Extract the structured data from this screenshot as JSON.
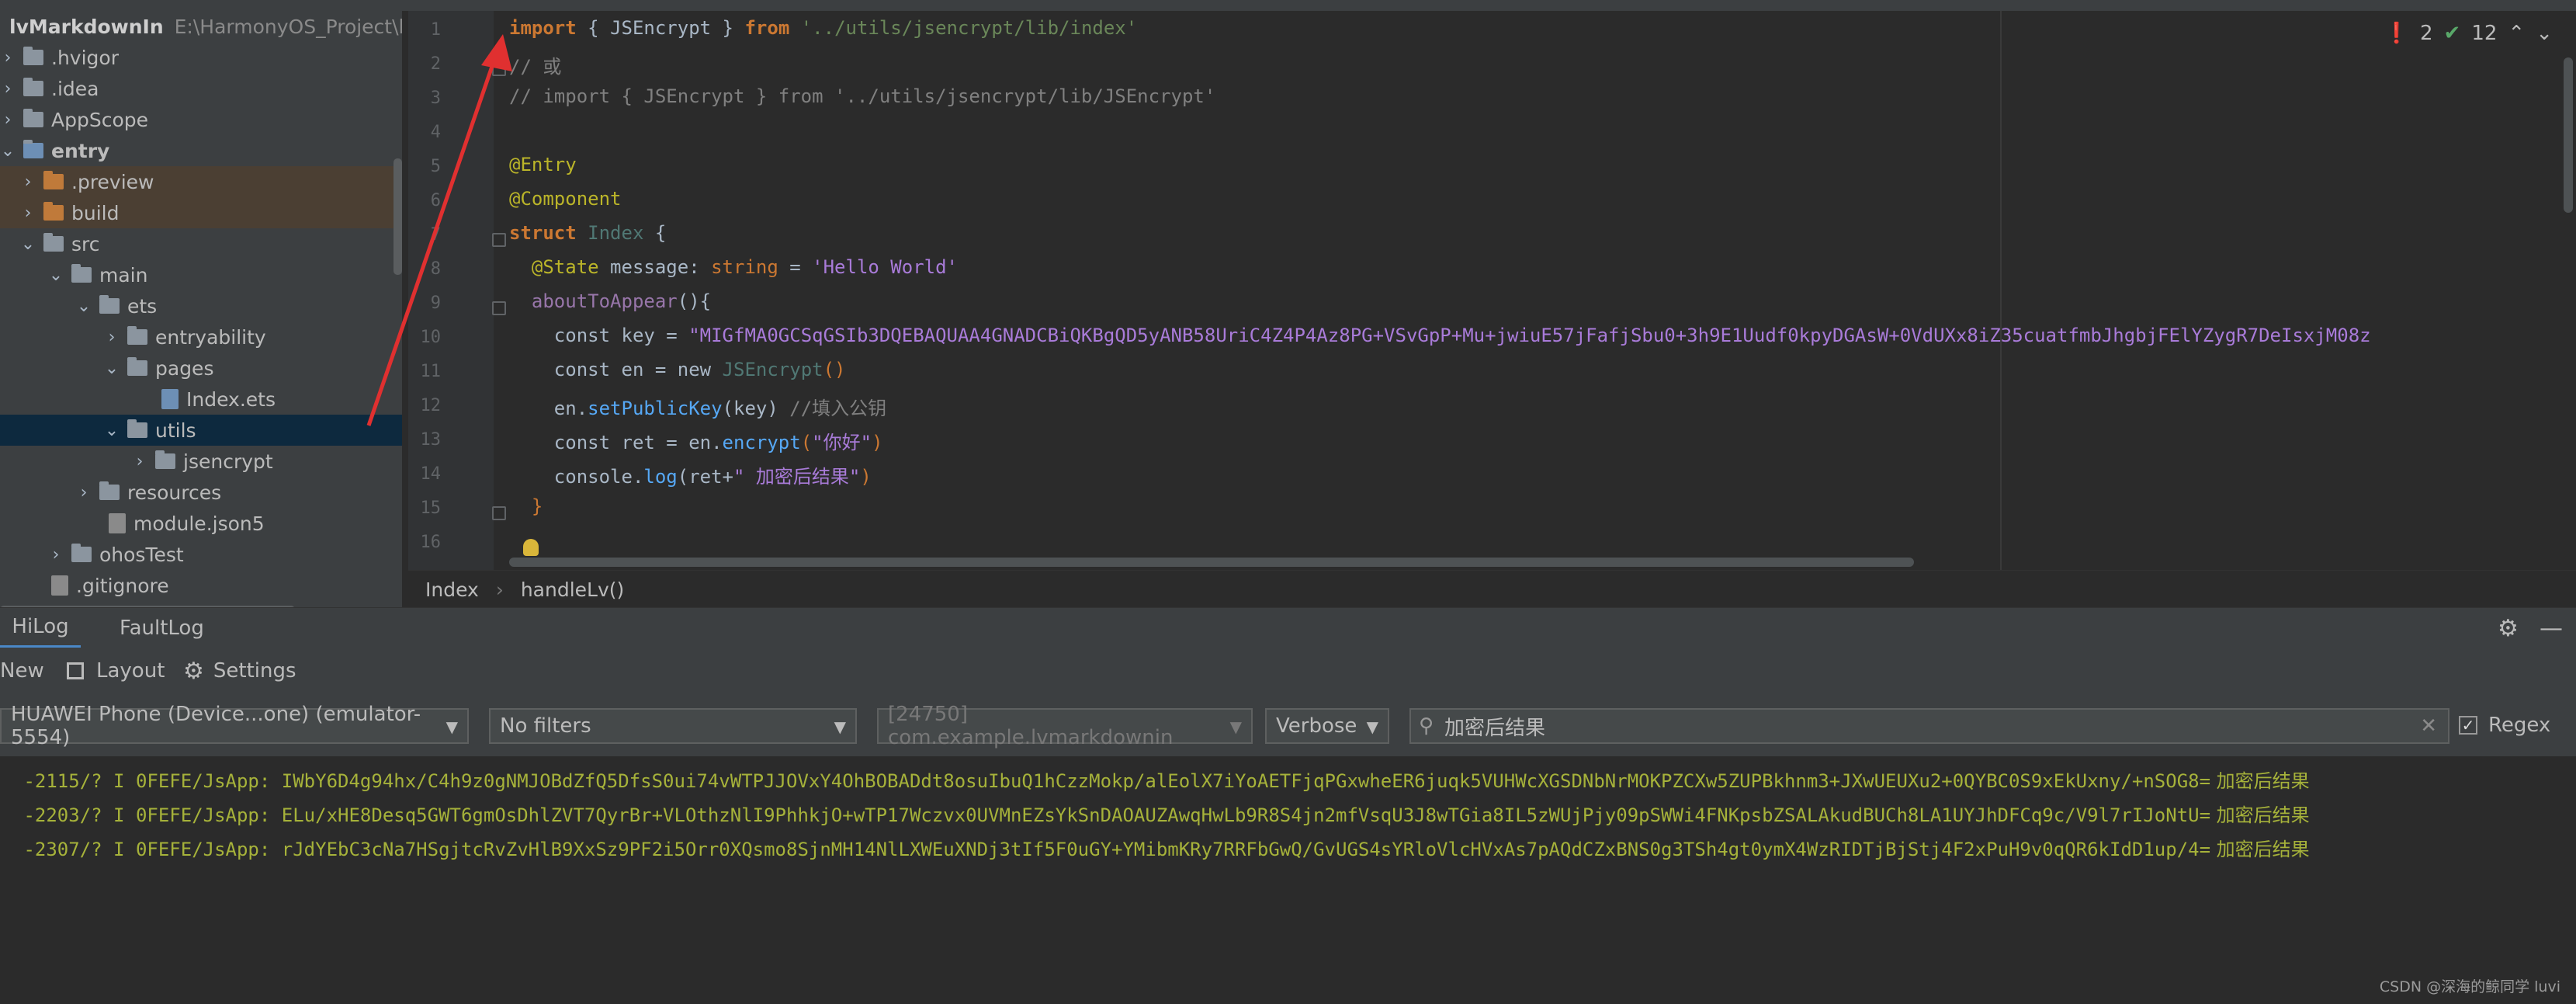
{
  "project": {
    "root_name": "lvMarkdownIn",
    "root_path": "E:\\HarmonyOS_Project\\lvM",
    "items": [
      {
        "label": ".hvigor",
        "kind": "folder"
      },
      {
        "label": ".idea",
        "kind": "folder"
      },
      {
        "label": "AppScope",
        "kind": "folder"
      },
      {
        "label": "entry",
        "kind": "folder"
      },
      {
        "label": ".preview",
        "kind": "folder-orange"
      },
      {
        "label": "build",
        "kind": "folder-orange"
      },
      {
        "label": "src",
        "kind": "folder"
      },
      {
        "label": "main",
        "kind": "folder"
      },
      {
        "label": "ets",
        "kind": "folder"
      },
      {
        "label": "entryability",
        "kind": "folder"
      },
      {
        "label": "pages",
        "kind": "folder"
      },
      {
        "label": "Index.ets",
        "kind": "file"
      },
      {
        "label": "utils",
        "kind": "folder"
      },
      {
        "label": "jsencrypt",
        "kind": "folder"
      },
      {
        "label": "resources",
        "kind": "folder"
      },
      {
        "label": "module.json5",
        "kind": "file"
      },
      {
        "label": "ohosTest",
        "kind": "folder"
      },
      {
        "label": ".gitignore",
        "kind": "file"
      }
    ]
  },
  "editor": {
    "line_numbers": [
      "1",
      "2",
      "3",
      "4",
      "5",
      "6",
      "7",
      "8",
      "9",
      "10",
      "11",
      "12",
      "13",
      "14",
      "15",
      "16"
    ],
    "code": {
      "l1_import": "import",
      "l1_open": " { ",
      "l1_name": "JSEncrypt",
      "l1_close": " } ",
      "l1_from": "from",
      "l1_path": " '../utils/jsencrypt/lib/index'",
      "l2": "// 或",
      "l3": "// import { JSEncrypt } from '../utils/jsencrypt/lib/JSEncrypt'",
      "l5": "@Entry",
      "l6": "@Component",
      "l7_struct": "struct",
      "l7_name": " Index",
      "l7_brace": " {",
      "l8_dec": "  @State",
      "l8_prop": " message",
      "l8_colon": ": ",
      "l8_type": "string",
      "l8_eq": " = ",
      "l8_val": "'Hello World'",
      "l9_fn": "  aboutToAppear",
      "l9_rest": "(){",
      "l10_const": "    const",
      "l10_rest": " key = ",
      "l10_val": "\"MIGfMA0GCSqGSIb3DQEBAQUAA4GNADCBiQKBgQD5yANB58UriC4Z4P4Az8PG+VSvGpP+Mu+jwiuE57jFafjSbu0+3h9E1Uudf0kpyDGAsW+0VdUXx8iZ35cuatfmbJhgbjFElYZygR7DeIsxjM08z",
      "l11_const": "    const",
      "l11_rest": " en = ",
      "l11_new": "new",
      "l11_cls": " JSEncrypt",
      "l11_paren": "()",
      "l12_obj": "    en.",
      "l12_fn": "setPublicKey",
      "l12_args": "(key) ",
      "l12_cmt": "//填入公钥",
      "l13_const": "    const",
      "l13_rest": " ret = en.",
      "l13_fn": "encrypt",
      "l13_open": "(",
      "l13_val": "\"你好\"",
      "l13_close": ")",
      "l14_obj": "    console.",
      "l14_fn": "log",
      "l14_open": "(ret+",
      "l14_val": "\" 加密后结果\"",
      "l14_close": ")",
      "l15": "  }"
    },
    "inspection": {
      "errors": "2",
      "ok": "12"
    }
  },
  "breadcrumb": {
    "items": [
      "Index",
      "handleLv()"
    ]
  },
  "panel": {
    "tabs": [
      "HiLog",
      "FaultLog"
    ],
    "toolbar": {
      "new": "New",
      "layout": "Layout",
      "settings": "Settings"
    },
    "device": "HUAWEI Phone (Device...one) (emulator-5554)",
    "filter": "No filters",
    "process": "[24750] com.example.lvmarkdownin",
    "level": "Verbose",
    "search_value": "加密后结果",
    "regex_label": "Regex",
    "regex_checked": true
  },
  "log": {
    "lines": [
      {
        "text": " -2115/? I 0FEFE/JsApp: IWbY6D4g94hx/C4h9z0gNMJOBdZfQ5DfsS0ui74vWTPJJOVxY4OhBOBADdt8osuIbuQ1hCzzMokp/alEolX7iYoAETFjqPGxwheER6juqk5VUHWcXGSDNbNrMOKPZCXw5ZUPBkhnm3+JXwUEUXu2+0QYBC0S9xEkUxny/+nSOG8=",
        "tail": " 加密后结果"
      },
      {
        "text": " -2203/? I 0FEFE/JsApp: ELu/xHE8Desq5GWT6gmOsDhlZVT7QyrBr+VLOthzNlI9PhhkjO+wTP17Wczvx0UVMnEZsYkSnDAOAUZAwqHwLb9R8S4jn2mfVsqU3J8wTGia8IL5zWUjPjy09pSWWi4FNKpsbZSALAkudBUCh8LA1UYJhDFCq9c/V9l7rIJoNtU=",
        "tail": " 加密后结果"
      },
      {
        "text": " -2307/? I 0FEFE/JsApp: rJdYEbC3cNa7HSgjtcRvZvHlB9XxSz9PF2i5Orr0XQsmo8SjnMH14NlLXWEuXNDj3tIf5F0uGY+YMibmKRy7RRFbGwQ/GvUGS4sYRloVlcHVxAs7pAQdCZxBNS0g3TSh4gt0ymX4WzRIDTjBjStj4F2xPuH9v0qQR6kIdD1up/4=",
        "tail": " 加密后结果"
      }
    ]
  },
  "watermark": "CSDN @深海的鲸同学 luvi",
  "colors": {
    "accent": "#4a88c7",
    "arrow": "#e03030",
    "log_text": "#a6b23a"
  }
}
